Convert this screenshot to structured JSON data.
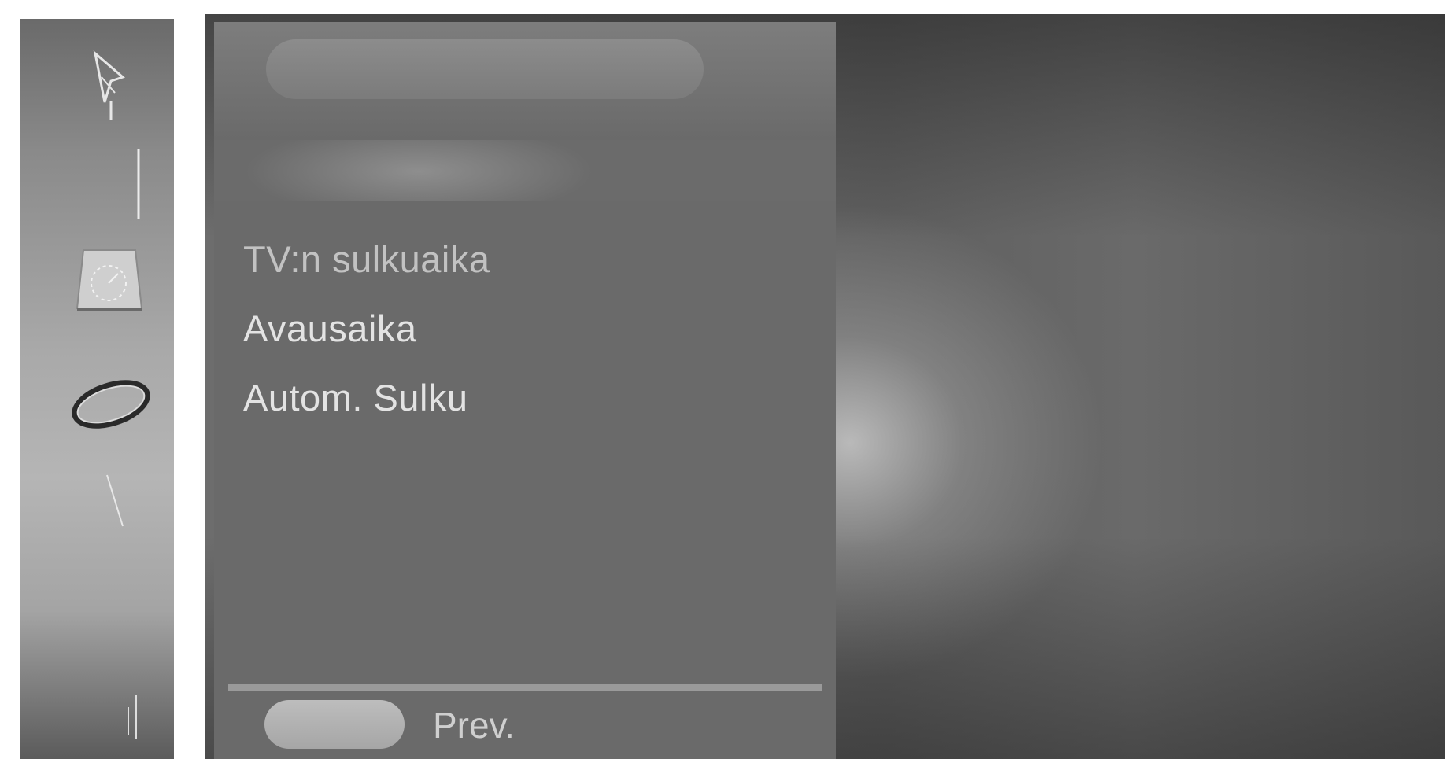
{
  "menu": {
    "title": "",
    "items": [
      {
        "label": "TV:n sulkuaika",
        "state": "highlighted"
      },
      {
        "label": "Avausaika",
        "state": "normal"
      },
      {
        "label": "Autom. Sulku",
        "state": "normal"
      }
    ]
  },
  "footer": {
    "prev_label": "Prev."
  },
  "sidebar": {
    "icons": [
      "setup-icon",
      "menu-line-icon",
      "time-icon",
      "option-icon",
      "menu-line-icon",
      "menu-line-icon"
    ]
  },
  "colors": {
    "panel": "#6c6c6c",
    "item_text": "#e3e3e3",
    "highlighted_text": "#c2c2c2",
    "prev_button": "#b0b0b0"
  }
}
